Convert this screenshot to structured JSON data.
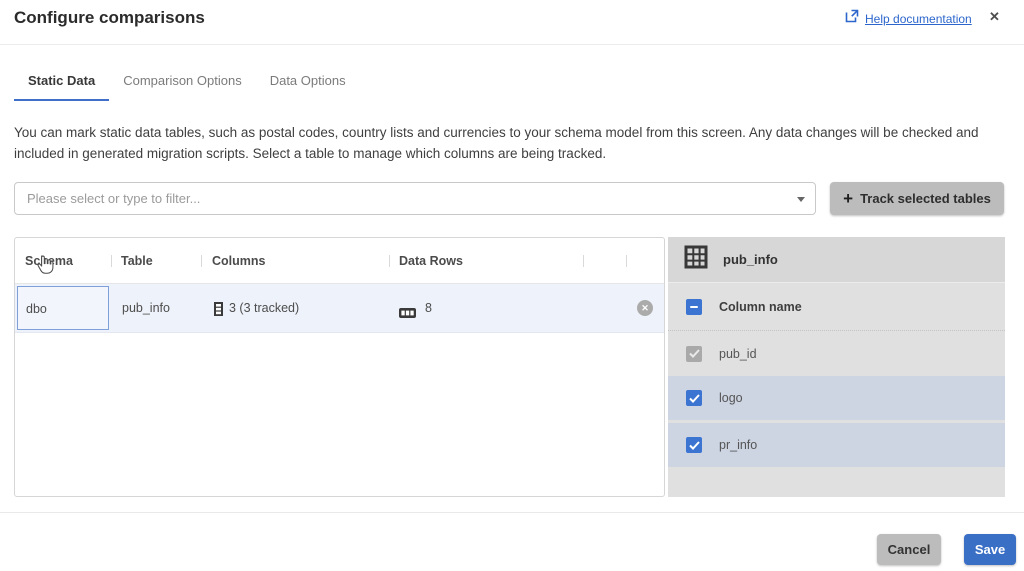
{
  "header": {
    "title": "Configure comparisons",
    "help_link": "Help documentation",
    "close_glyph": "✕"
  },
  "tabs": [
    {
      "label": "Static Data",
      "active": true
    },
    {
      "label": "Comparison Options",
      "active": false
    },
    {
      "label": "Data Options",
      "active": false
    }
  ],
  "description": "You can mark static data tables, such as postal codes, country lists and currencies to your schema model from this screen. Any data changes will be checked and included in generated migration scripts. Select a table to manage which columns are being tracked.",
  "filter": {
    "placeholder": "Please select or type to filter..."
  },
  "track_button": {
    "label": "Track selected tables",
    "plus_glyph": "+"
  },
  "table": {
    "headers": [
      "Schema",
      "Table",
      "Columns",
      "Data Rows"
    ],
    "rows": [
      {
        "schema": "dbo",
        "table": "pub_info",
        "columns": "3 (3 tracked)",
        "data_rows": "8"
      }
    ],
    "remove_glyph": "✕"
  },
  "panel": {
    "title": "pub_info",
    "header_label": "Column name",
    "header_checkbox_state": "indeterminate",
    "columns": [
      {
        "name": "pub_id",
        "checked": true,
        "disabled": true
      },
      {
        "name": "logo",
        "checked": true,
        "disabled": false
      },
      {
        "name": "pr_info",
        "checked": true,
        "disabled": false
      }
    ]
  },
  "footer": {
    "cancel_label": "Cancel",
    "save_label": "Save"
  },
  "colors": {
    "accent_blue": "#3b74d1",
    "link_blue": "#2c66cc",
    "tab_underline": "#3f6fc8",
    "selected_row_bg": "#eef2fa",
    "selected_cell_border": "#7e9fd8",
    "panel_bg": "#e0e0e0",
    "checked_row_bg": "#cdd4e2",
    "gray_button_bg": "#bcbcbc",
    "save_button_bg": "#3a6fc6"
  }
}
